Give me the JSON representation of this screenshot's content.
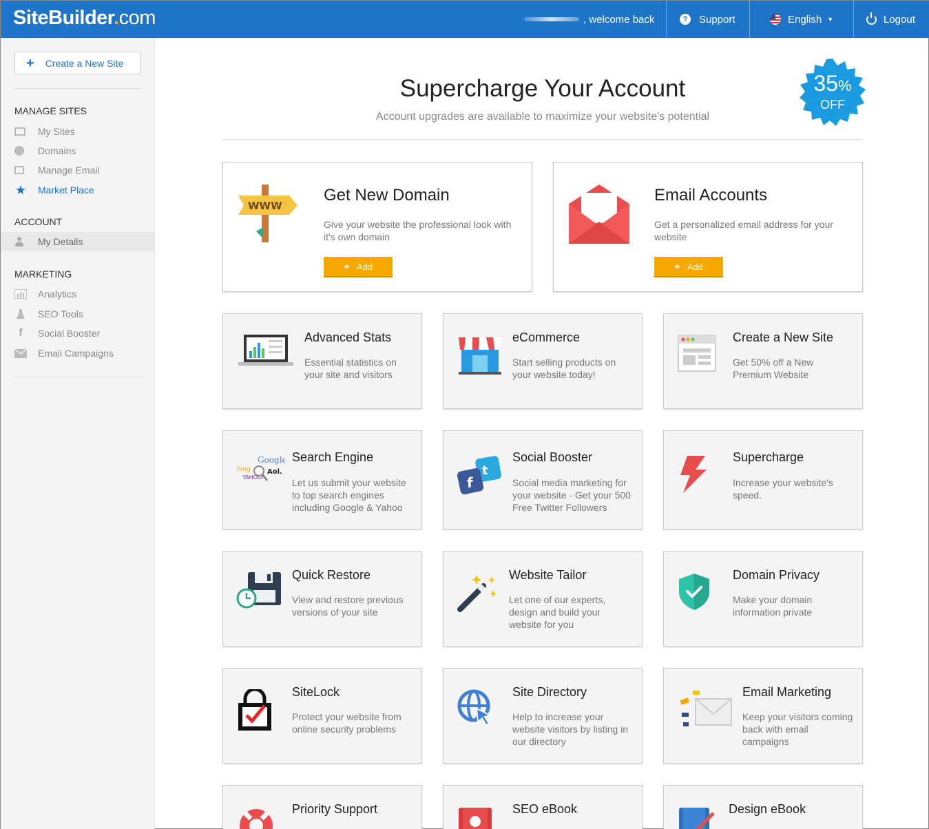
{
  "header": {
    "logo_main": "SiteBuilder",
    "logo_dot": ".",
    "logo_tld": "com",
    "welcome": ", welcome back",
    "support": "Support",
    "language": "English",
    "logout": "Logout"
  },
  "sidebar": {
    "create_label": "Create a New Site",
    "manage_heading": "MANAGE SITES",
    "manage_items": [
      "My Sites",
      "Domains",
      "Manage Email",
      "Market Place"
    ],
    "account_heading": "ACCOUNT",
    "account_items": [
      "My Details"
    ],
    "marketing_heading": "MARKETING",
    "marketing_items": [
      "Analytics",
      "SEO Tools",
      "Social Booster",
      "Email Campaigns"
    ]
  },
  "main": {
    "title": "Supercharge Your Account",
    "subtitle": "Account upgrades are available to maximize your website's potential",
    "badge_pct": "35",
    "badge_pct_sign": "%",
    "badge_off": "OFF",
    "featured": [
      {
        "title": "Get New Domain",
        "desc": "Give your website the professional look with it's own domain",
        "button": "Add",
        "sign_text": "WWW"
      },
      {
        "title": "Email Accounts",
        "desc": "Get a personalized email address for your website",
        "button": "Add"
      }
    ],
    "cards": [
      {
        "title": "Advanced Stats",
        "desc": "Essential statistics on your site and visitors"
      },
      {
        "title": "eCommerce",
        "desc": "Start selling products on your website today!"
      },
      {
        "title": "Create a New Site",
        "desc": "Get 50% off a New Premium Website"
      },
      {
        "title": "Search Engine",
        "desc": "Let us submit your website to top search engines including Google & Yahoo"
      },
      {
        "title": "Social Booster",
        "desc": "Social media marketing for your website - Get your 500 Free Twitter Followers"
      },
      {
        "title": "Supercharge",
        "desc": "Increase your website's speed."
      },
      {
        "title": "Quick Restore",
        "desc": "View and restore previous versions of your site"
      },
      {
        "title": "Website Tailor",
        "desc": "Let one of our experts, design and build your website for you"
      },
      {
        "title": "Domain Privacy",
        "desc": "Make your domain information private"
      },
      {
        "title": "SiteLock",
        "desc": "Protect your website from online security problems"
      },
      {
        "title": "Site Directory",
        "desc": "Help to increase your website visitors by listing in our directory"
      },
      {
        "title": "Email Marketing",
        "desc": "Keep your visitors coming back with email campaigns"
      },
      {
        "title": "Priority Support",
        "desc": ""
      },
      {
        "title": "SEO eBook",
        "desc": ""
      },
      {
        "title": "Design eBook",
        "desc": ""
      }
    ],
    "search_logos": [
      "Google",
      "bing",
      "Aol.",
      "YAHOO!"
    ]
  },
  "colors": {
    "brand_blue": "#1d74c8",
    "add_orange": "#f5a800",
    "badge_blue": "#1a9ae0"
  }
}
